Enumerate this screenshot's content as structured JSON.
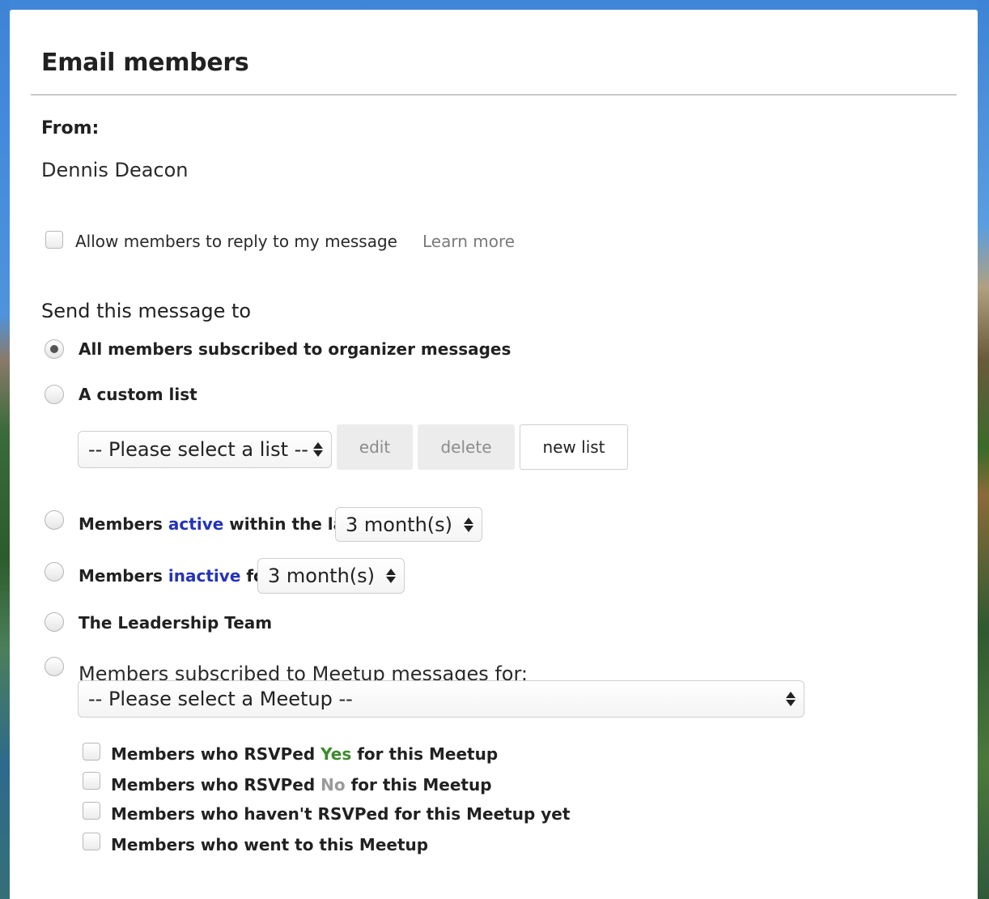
{
  "dialog": {
    "title": "Email members"
  },
  "from": {
    "label": "From:",
    "name": "Dennis Deacon"
  },
  "reply": {
    "label": "Allow members to reply to my message",
    "learn_more": "Learn more",
    "checked": false
  },
  "recipients": {
    "heading": "Send this message to",
    "all_members": "All members subscribed to organizer messages",
    "custom_list": "A custom list",
    "list_select": "-- Please select a list --",
    "edit_button": "edit",
    "delete_button": "delete",
    "new_list_button": "new list",
    "active_pre": "Members ",
    "active_link": "active",
    "active_post": " within the last",
    "active_select": "3 month(s)",
    "inactive_pre": "Members ",
    "inactive_link": "inactive",
    "inactive_post": " for",
    "inactive_select": "3 month(s)",
    "leadership": "The Leadership Team",
    "meetup_label": "Members subscribed to Meetup messages for:",
    "meetup_select": "-- Please select a Meetup --",
    "selected_option": "All members subscribed to organizer messages"
  },
  "meetup_filters": {
    "rsvp_yes_pre": "Members who RSVPed ",
    "rsvp_yes_word": "Yes",
    "rsvp_yes_post": " for this Meetup",
    "rsvp_no_pre": "Members who RSVPed ",
    "rsvp_no_word": "No",
    "rsvp_no_post": " for this Meetup",
    "not_rsvped": "Members who haven't RSVPed for this Meetup yet",
    "went": "Members who went to this Meetup"
  },
  "colors": {
    "link_blue": "#2433b8",
    "yes_green": "#3c8a2e",
    "no_gray": "#9a9a9a"
  }
}
